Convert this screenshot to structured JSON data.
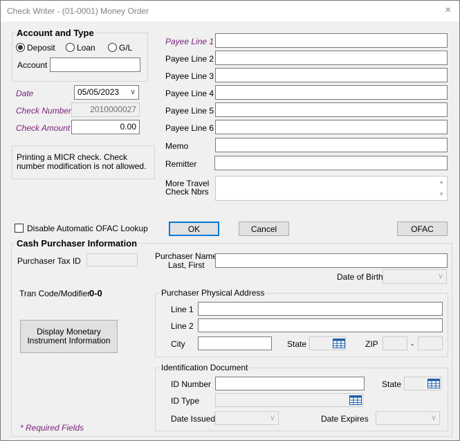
{
  "window": {
    "title": "Check Writer - (01-0001) Money Order",
    "close_glyph": "×"
  },
  "account": {
    "group_title": "Account and Type",
    "radios": [
      {
        "label": "Deposit",
        "selected": true
      },
      {
        "label": "Loan",
        "selected": false
      },
      {
        "label": "G/L",
        "selected": false
      }
    ],
    "account_label": "Account",
    "account_value": ""
  },
  "check": {
    "date_label": "Date",
    "date_value": "05/05/2023",
    "number_label": "Check Number",
    "number_value": "2010000027",
    "amount_label": "Check Amount",
    "amount_value": "0.00",
    "micr_message": "Printing a MICR check. Check number modification is not allowed."
  },
  "payee": {
    "lines": [
      {
        "label": "Payee Line 1",
        "value": ""
      },
      {
        "label": "Payee Line 2",
        "value": ""
      },
      {
        "label": "Payee Line 3",
        "value": ""
      },
      {
        "label": "Payee Line 4",
        "value": ""
      },
      {
        "label": "Payee Line 5",
        "value": ""
      },
      {
        "label": "Payee Line 6",
        "value": ""
      }
    ],
    "memo_label": "Memo",
    "remitter_label": "Remitter",
    "travel_label_1": "More Travel",
    "travel_label_2": "Check Nbrs"
  },
  "actions": {
    "ofac_disable_label": "Disable Automatic OFAC Lookup",
    "ofac_disable_checked": false,
    "ok_label": "OK",
    "cancel_label": "Cancel",
    "ofac_label": "OFAC"
  },
  "purchaser": {
    "section_title": "Cash Purchaser Information",
    "tax_id_label": "Purchaser Tax ID",
    "name_label_1": "Purchaser Name:",
    "name_label_2": "Last, First",
    "dob_label": "Date of Birth",
    "tran_code_label": "Tran Code/Modifier",
    "tran_code_value": "0-0",
    "monetary_button_1": "Display Monetary",
    "monetary_button_2": "Instrument Information",
    "required_note": "* Required Fields"
  },
  "address": {
    "group_title": "Purchaser Physical Address",
    "line1_label": "Line 1",
    "line2_label": "Line 2",
    "city_label": "City",
    "state_label": "State",
    "zip_label": "ZIP",
    "zip_separator": "-"
  },
  "identification": {
    "group_title": "Identification Document",
    "id_number_label": "ID Number",
    "state_label": "State",
    "id_type_label": "ID Type",
    "date_issued_label": "Date Issued",
    "date_expires_label": "Date Expires"
  },
  "colors": {
    "required_label": "#7a1f7a",
    "default_button_border": "#0078d7",
    "lookup_icon": "#1e5ea8"
  }
}
